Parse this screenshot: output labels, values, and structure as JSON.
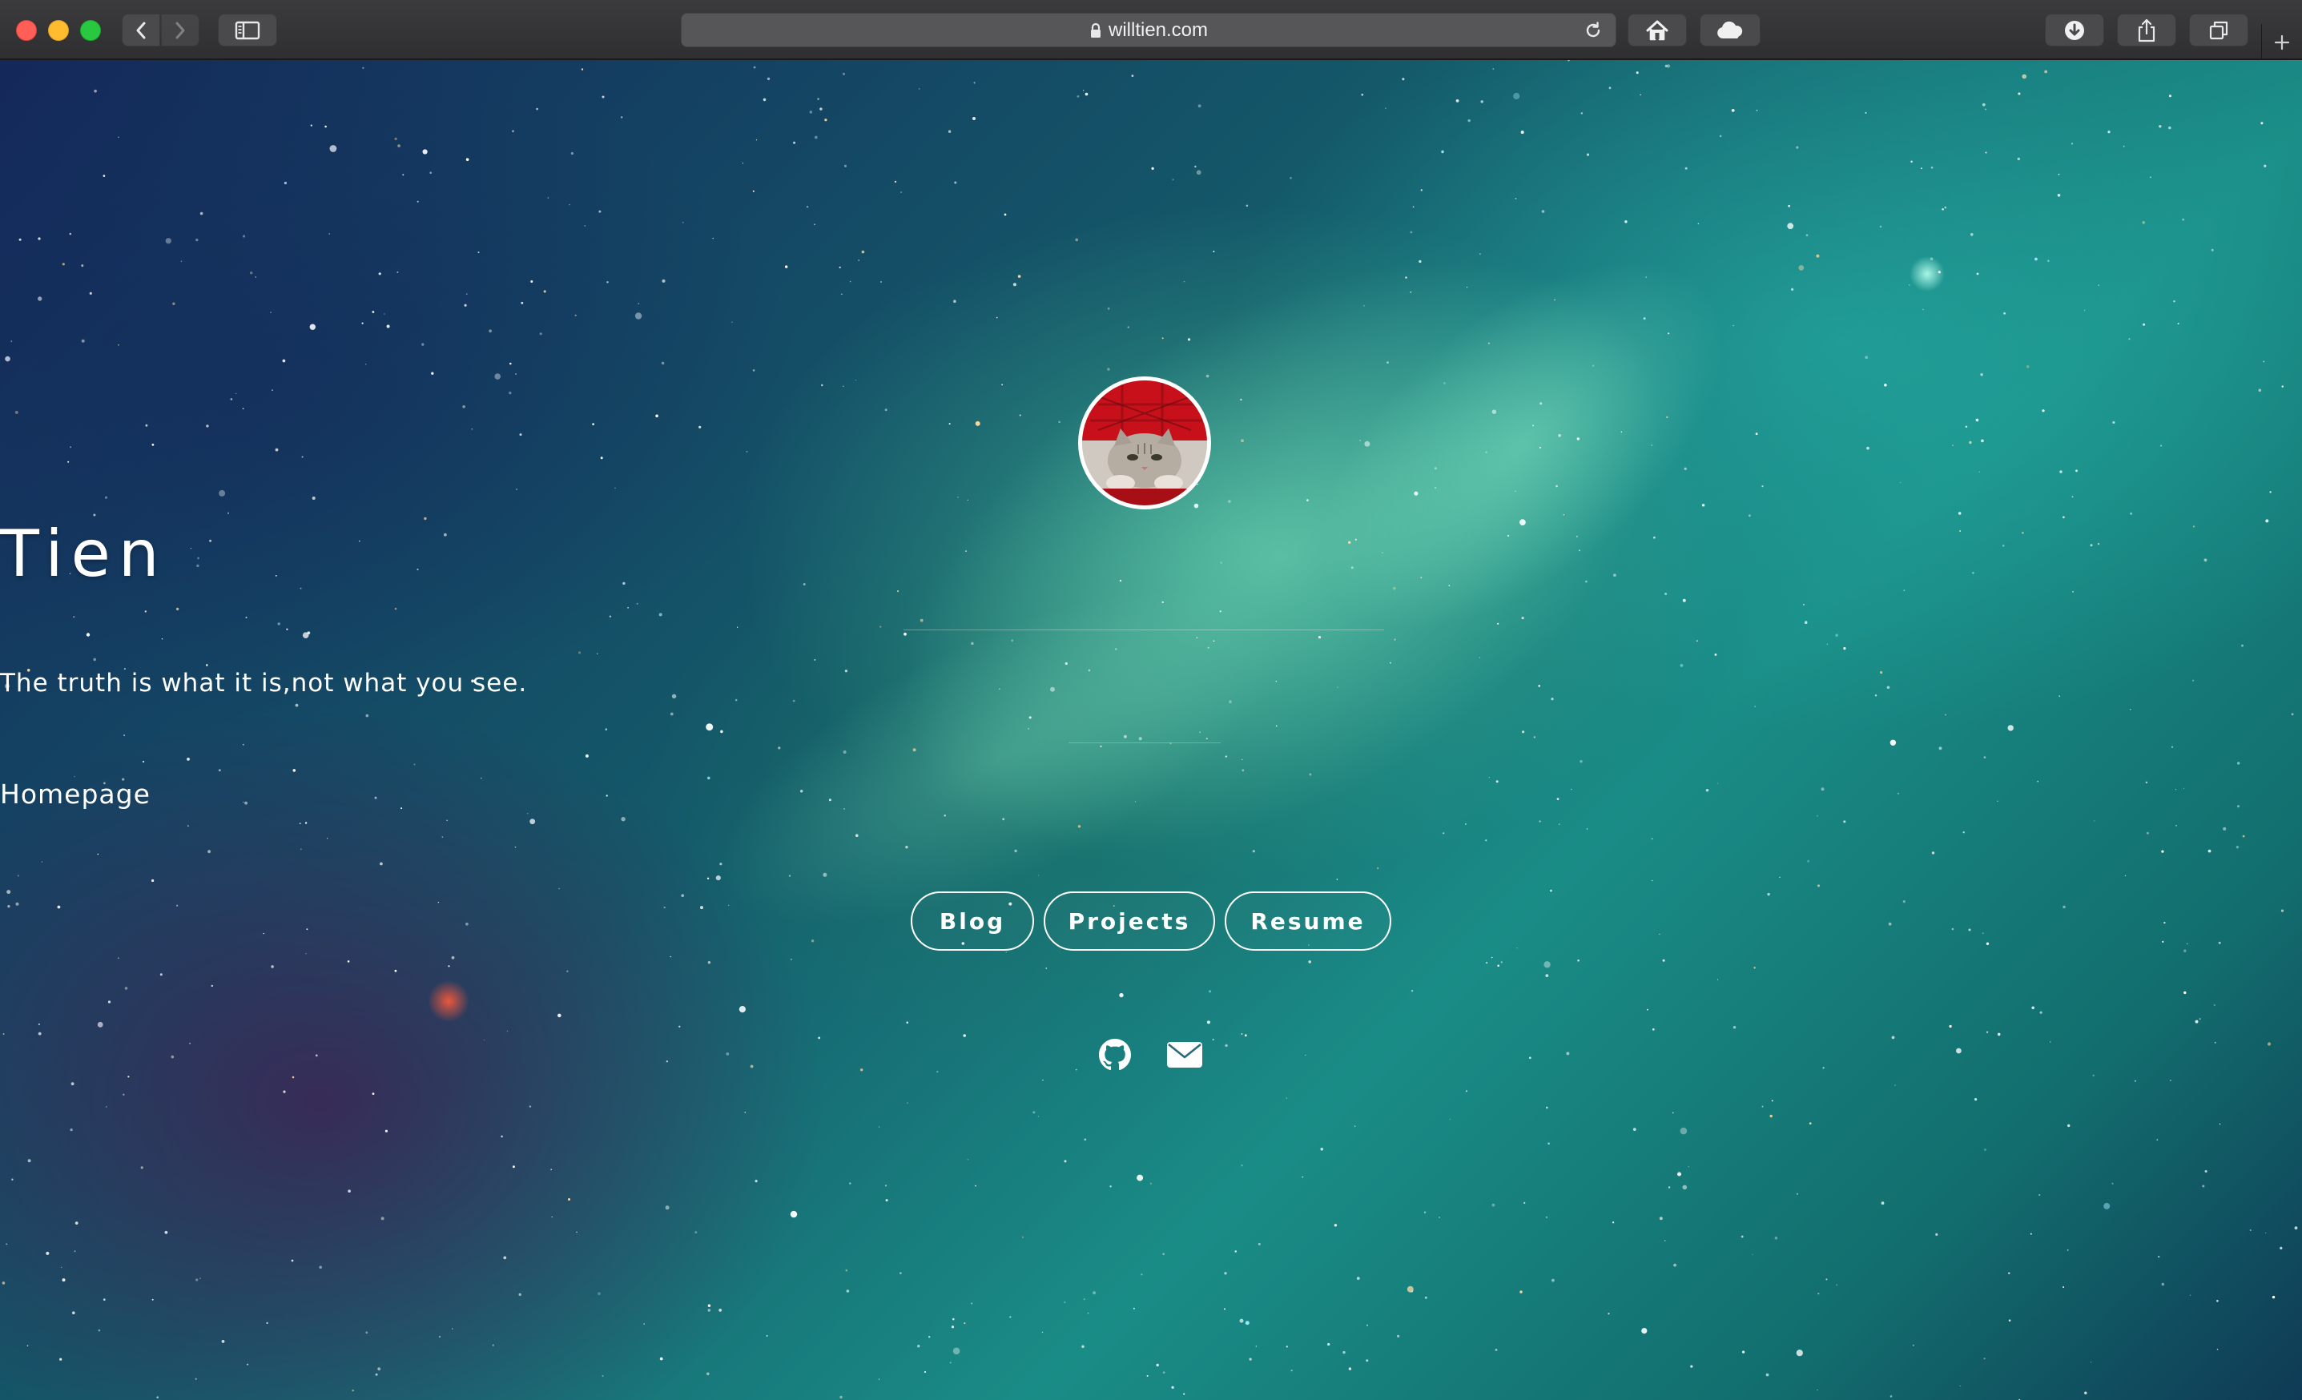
{
  "browser": {
    "url": "willtien.com",
    "colors": {
      "toolbar": "#353537",
      "address_bar": "#565658",
      "close": "#ff5f57",
      "minimize": "#febc2e",
      "maximize": "#28c840"
    },
    "icons": {
      "back": "chevron-left-icon",
      "forward": "chevron-right-icon",
      "sidebar": "sidebar-icon",
      "lock": "lock-icon",
      "reload": "reload-icon",
      "home": "home-icon",
      "cloud": "cloud-icon",
      "download": "download-icon",
      "share": "share-icon",
      "tabs": "tabs-icon",
      "new_tab": "plus-icon"
    }
  },
  "profile": {
    "name": "Tien",
    "tagline": "The truth is what it is,not what you see.",
    "section_label": "Homepage",
    "buttons": [
      "Blog",
      "Projects",
      "Resume"
    ],
    "social_icons": [
      "github-icon",
      "mail-icon"
    ]
  }
}
